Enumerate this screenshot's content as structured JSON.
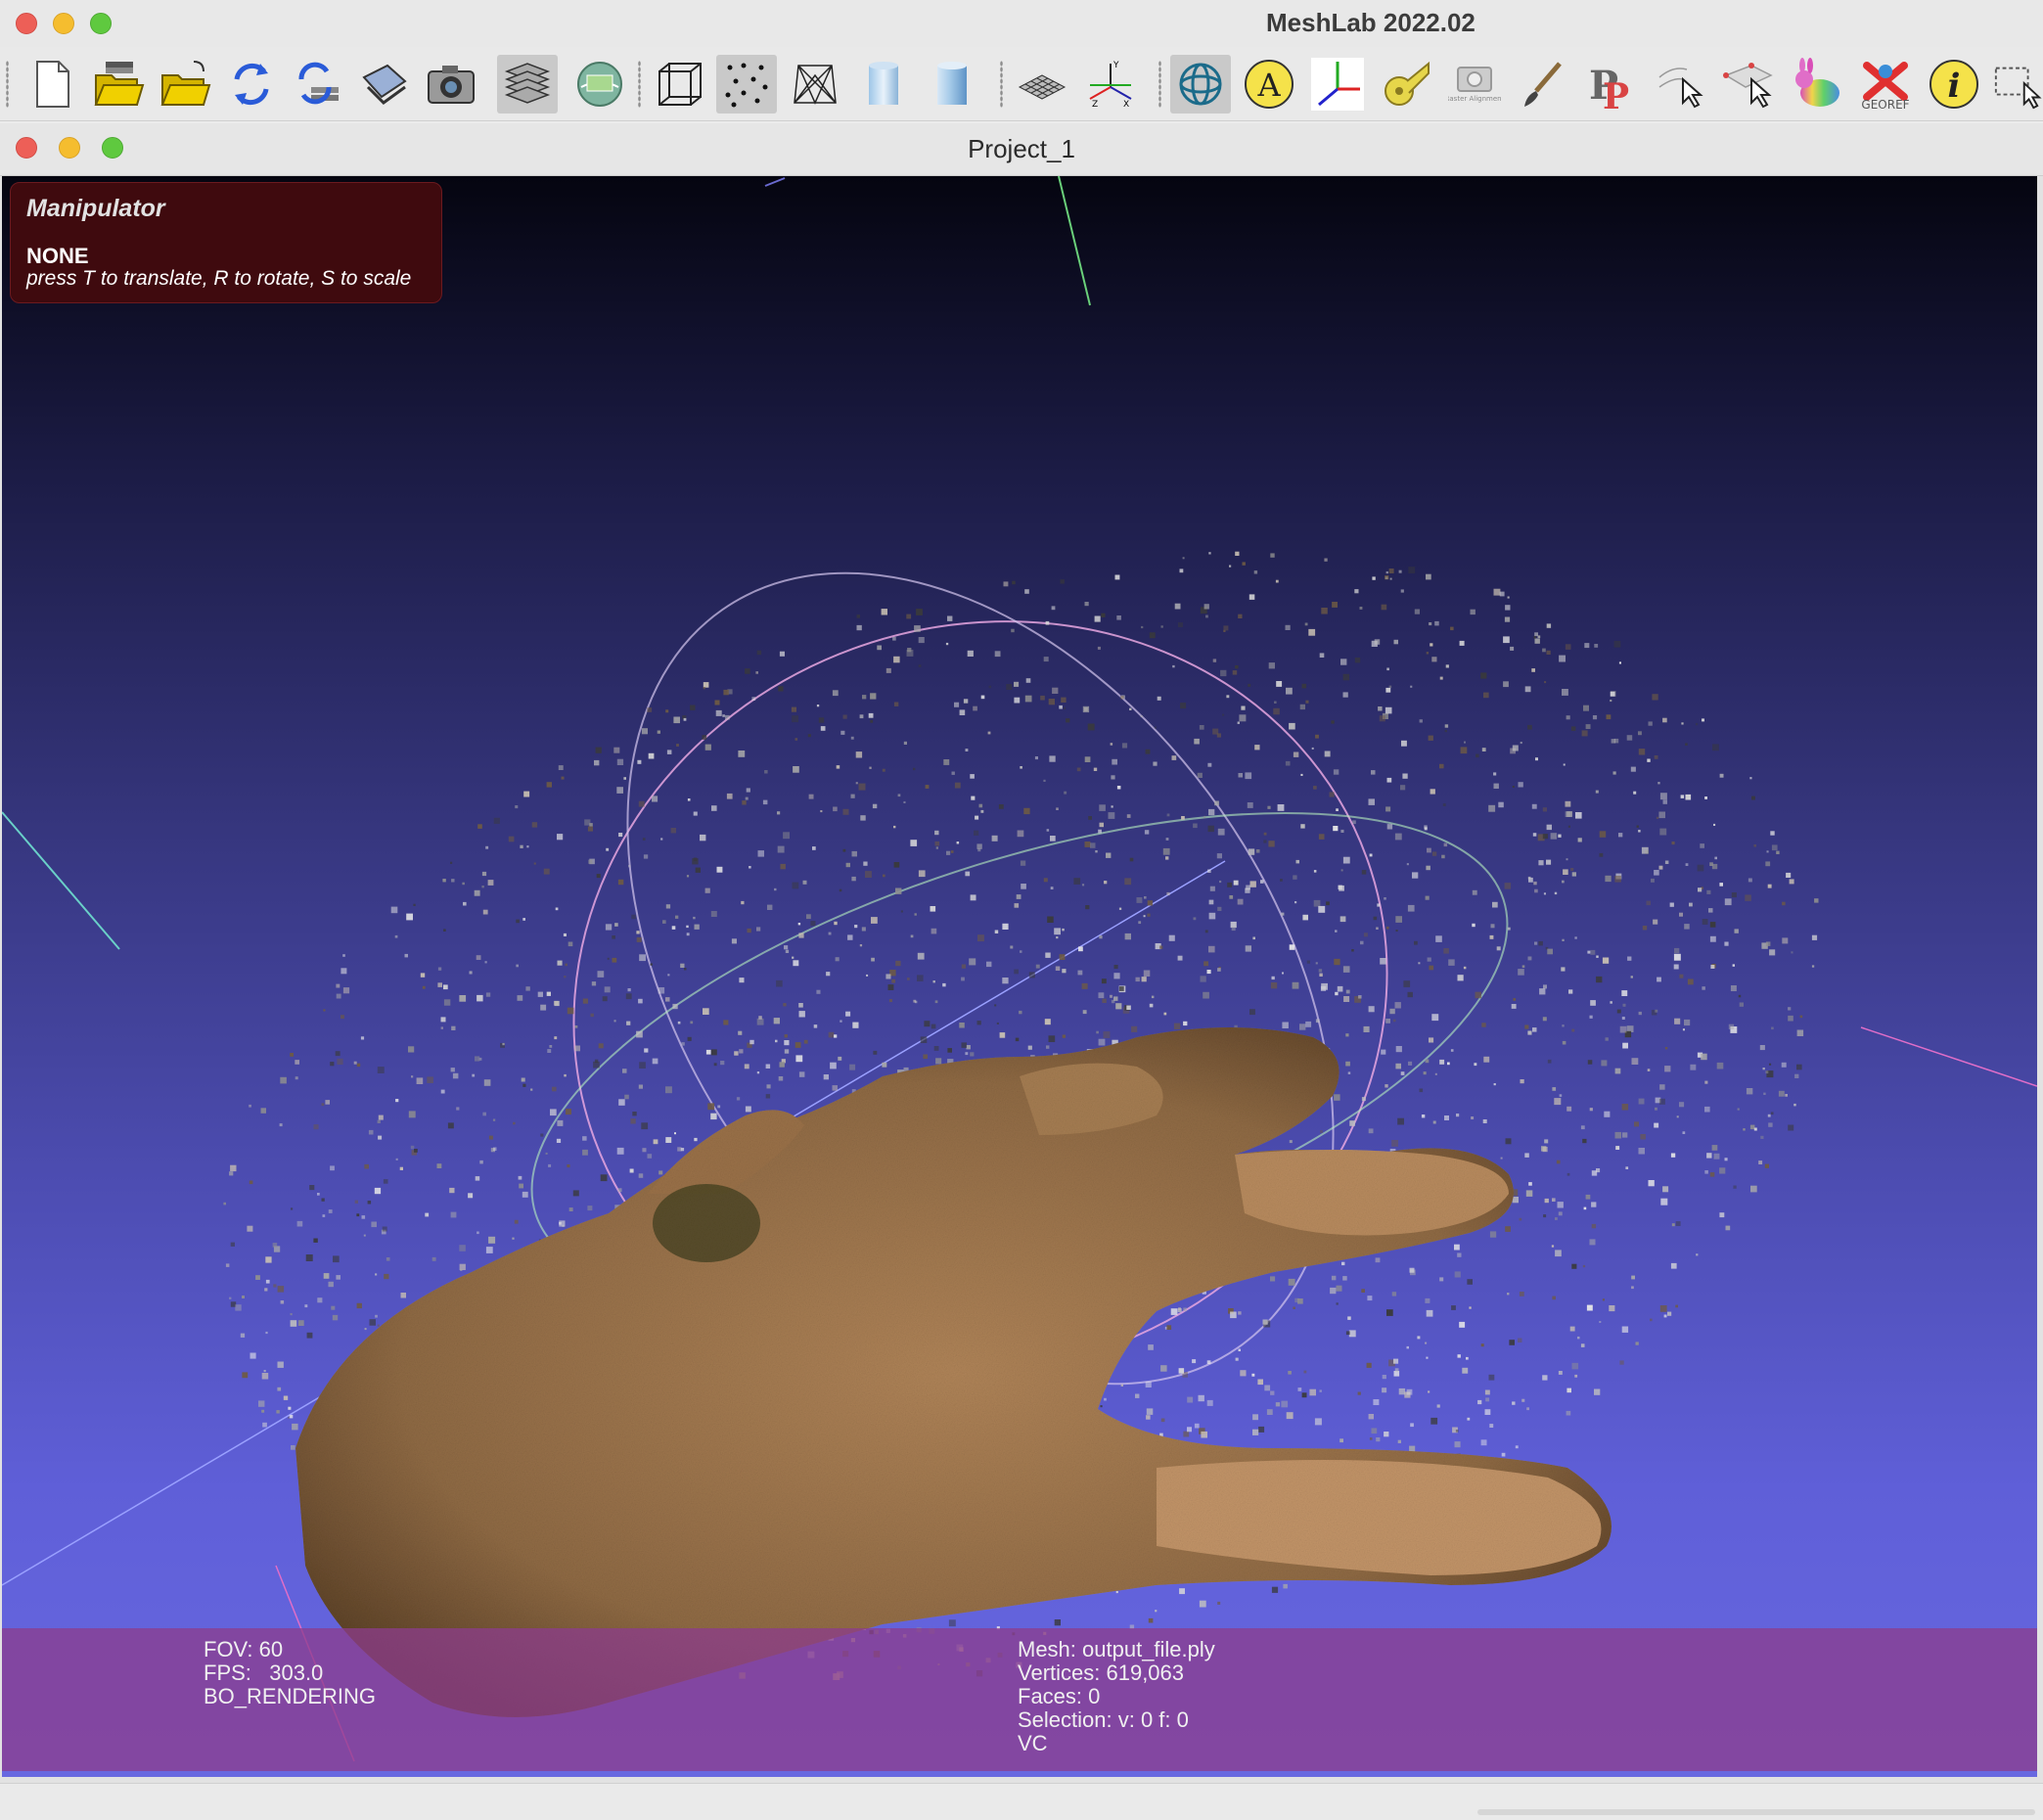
{
  "app": {
    "title": "MeshLab 2022.02"
  },
  "toolbar": {
    "buttons": [
      {
        "icon": "new-project-icon",
        "active": false
      },
      {
        "icon": "open-project-icon",
        "active": false
      },
      {
        "icon": "import-mesh-icon",
        "active": false
      },
      {
        "icon": "reload-icon",
        "active": false
      },
      {
        "icon": "reload-all-icon",
        "active": false
      },
      {
        "icon": "export-mesh-icon",
        "active": false
      },
      {
        "icon": "snapshot-icon",
        "active": false
      },
      {
        "icon": "layers-icon",
        "active": true
      },
      {
        "icon": "raster-view-icon",
        "active": false
      },
      {
        "icon": "bounding-box-icon",
        "active": false
      },
      {
        "icon": "points-icon",
        "active": true
      },
      {
        "icon": "wireframe-icon",
        "active": false
      },
      {
        "icon": "flat-shading-icon",
        "active": false
      },
      {
        "icon": "smooth-shading-icon",
        "active": false
      },
      {
        "icon": "grid-icon",
        "active": false
      },
      {
        "icon": "axis-icon",
        "active": false
      },
      {
        "icon": "trackball-icon",
        "active": true
      },
      {
        "icon": "annotation-icon",
        "active": false
      },
      {
        "icon": "manipulator-icon",
        "active": false
      },
      {
        "icon": "measure-icon",
        "active": false
      },
      {
        "icon": "raster-alignment-icon",
        "active": false,
        "label": "Raster Alignment"
      },
      {
        "icon": "paint-icon",
        "active": false
      },
      {
        "icon": "pick-points-icon",
        "active": false
      },
      {
        "icon": "select-vertices-icon",
        "active": false
      },
      {
        "icon": "select-faces-icon",
        "active": false
      },
      {
        "icon": "bunny-icon",
        "active": false
      },
      {
        "icon": "georef-icon",
        "active": false,
        "label": "GEOREF"
      },
      {
        "icon": "info-icon",
        "active": false
      },
      {
        "icon": "selection-rect-icon",
        "active": false
      }
    ]
  },
  "document": {
    "title": "Project_1"
  },
  "manipulator": {
    "title": "Manipulator",
    "state": "NONE",
    "hint": "press T to translate, R to rotate, S to scale"
  },
  "info": {
    "fov": "FOV: 60",
    "fps": "FPS:   303.0",
    "render_mode": "BO_RENDERING",
    "mesh": "Mesh: output_file.ply",
    "vertices": "Vertices: 619,063",
    "faces": "Faces: 0",
    "selection": "Selection: v: 0 f: 0",
    "color_mode": "VC"
  },
  "colors": {
    "bg_top": "#050510",
    "bg_bottom": "#6868e0",
    "skin": "#a27a52",
    "info_bar": "#8c3c8c",
    "manip_panel": "#3f0a0e"
  }
}
